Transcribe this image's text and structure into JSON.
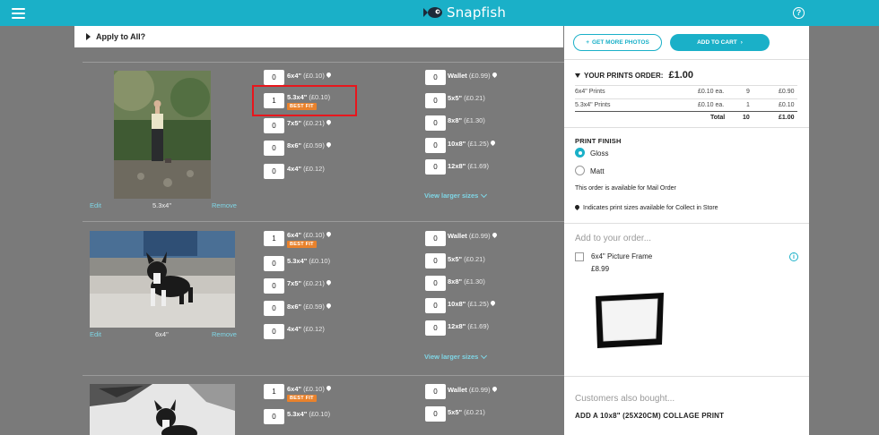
{
  "header": {
    "brand": "Snapfish"
  },
  "apply_all": {
    "label": "Apply to All?"
  },
  "photos": [
    {
      "caption": "5.3x4\"",
      "edit": "Edit",
      "remove": "Remove",
      "view_larger": "View larger sizes",
      "left_sizes": [
        {
          "qty": "0",
          "size": "6x4\"",
          "price": "(£0.10)",
          "pin": true,
          "best_fit": false
        },
        {
          "qty": "1",
          "size": "5.3x4\"",
          "price": "(£0.10)",
          "pin": false,
          "best_fit": true
        },
        {
          "qty": "0",
          "size": "7x5\"",
          "price": "(£0.21)",
          "pin": true,
          "best_fit": false
        },
        {
          "qty": "0",
          "size": "8x6\"",
          "price": "(£0.59)",
          "pin": true,
          "best_fit": false
        },
        {
          "qty": "0",
          "size": "4x4\"",
          "price": "(£0.12)",
          "pin": false,
          "best_fit": false
        }
      ],
      "right_sizes": [
        {
          "qty": "0",
          "size": "Wallet",
          "price": "(£0.99)",
          "pin": true
        },
        {
          "qty": "0",
          "size": "5x5\"",
          "price": "(£0.21)",
          "pin": false
        },
        {
          "qty": "0",
          "size": "8x8\"",
          "price": "(£1.30)",
          "pin": false
        },
        {
          "qty": "0",
          "size": "10x8\"",
          "price": "(£1.25)",
          "pin": true
        },
        {
          "qty": "0",
          "size": "12x8\"",
          "price": "(£1.69)",
          "pin": false
        }
      ]
    },
    {
      "caption": "6x4\"",
      "edit": "Edit",
      "remove": "Remove",
      "view_larger": "View larger sizes",
      "left_sizes": [
        {
          "qty": "1",
          "size": "6x4\"",
          "price": "(£0.10)",
          "pin": true,
          "best_fit": true
        },
        {
          "qty": "0",
          "size": "5.3x4\"",
          "price": "(£0.10)",
          "pin": false,
          "best_fit": false
        },
        {
          "qty": "0",
          "size": "7x5\"",
          "price": "(£0.21)",
          "pin": true,
          "best_fit": false
        },
        {
          "qty": "0",
          "size": "8x6\"",
          "price": "(£0.59)",
          "pin": true,
          "best_fit": false
        },
        {
          "qty": "0",
          "size": "4x4\"",
          "price": "(£0.12)",
          "pin": false,
          "best_fit": false
        }
      ],
      "right_sizes": [
        {
          "qty": "0",
          "size": "Wallet",
          "price": "(£0.99)",
          "pin": true
        },
        {
          "qty": "0",
          "size": "5x5\"",
          "price": "(£0.21)",
          "pin": false
        },
        {
          "qty": "0",
          "size": "8x8\"",
          "price": "(£1.30)",
          "pin": false
        },
        {
          "qty": "0",
          "size": "10x8\"",
          "price": "(£1.25)",
          "pin": true
        },
        {
          "qty": "0",
          "size": "12x8\"",
          "price": "(£1.69)",
          "pin": false
        }
      ]
    },
    {
      "left_sizes": [
        {
          "qty": "1",
          "size": "6x4\"",
          "price": "(£0.10)",
          "pin": true,
          "best_fit": true
        },
        {
          "qty": "0",
          "size": "5.3x4\"",
          "price": "(£0.10)",
          "pin": false,
          "best_fit": false
        }
      ],
      "right_sizes": [
        {
          "qty": "0",
          "size": "Wallet",
          "price": "(£0.99)",
          "pin": true
        },
        {
          "qty": "0",
          "size": "5x5\"",
          "price": "(£0.21)",
          "pin": false
        }
      ]
    }
  ],
  "best_fit_label": "BEST FIT",
  "cart": {
    "get_more_photos": "GET MORE PHOTOS",
    "add_to_cart": "ADD TO CART",
    "order_title": "YOUR PRINTS ORDER:",
    "order_total": "£1.00",
    "rows": [
      {
        "name": "6x4\" Prints",
        "each": "£0.10 ea.",
        "qty": "9",
        "total": "£0.90"
      },
      {
        "name": "5.3x4\" Prints",
        "each": "£0.10 ea.",
        "qty": "1",
        "total": "£0.10"
      }
    ],
    "total_row": {
      "label": "Total",
      "qty": "10",
      "total": "£1.00"
    },
    "finish_title": "PRINT FINISH",
    "finish_options": [
      {
        "label": "Gloss",
        "selected": true
      },
      {
        "label": "Matt",
        "selected": false
      }
    ],
    "mail_order_note": "This order is available for Mail Order",
    "collect_note": "Indicates print sizes available for Collect in Store",
    "add_to_order": "Add to your order...",
    "addon": {
      "label": "6x4\" Picture Frame",
      "price": "£8.99"
    },
    "also_bought": "Customers also bought...",
    "also_item": "ADD A 10x8\" (25X20CM) COLLAGE PRINT"
  },
  "colors": {
    "brand": "#1ab0c8",
    "highlight": "#e8161c",
    "best_fit": "#e9822c",
    "link": "#7fd6e6"
  }
}
